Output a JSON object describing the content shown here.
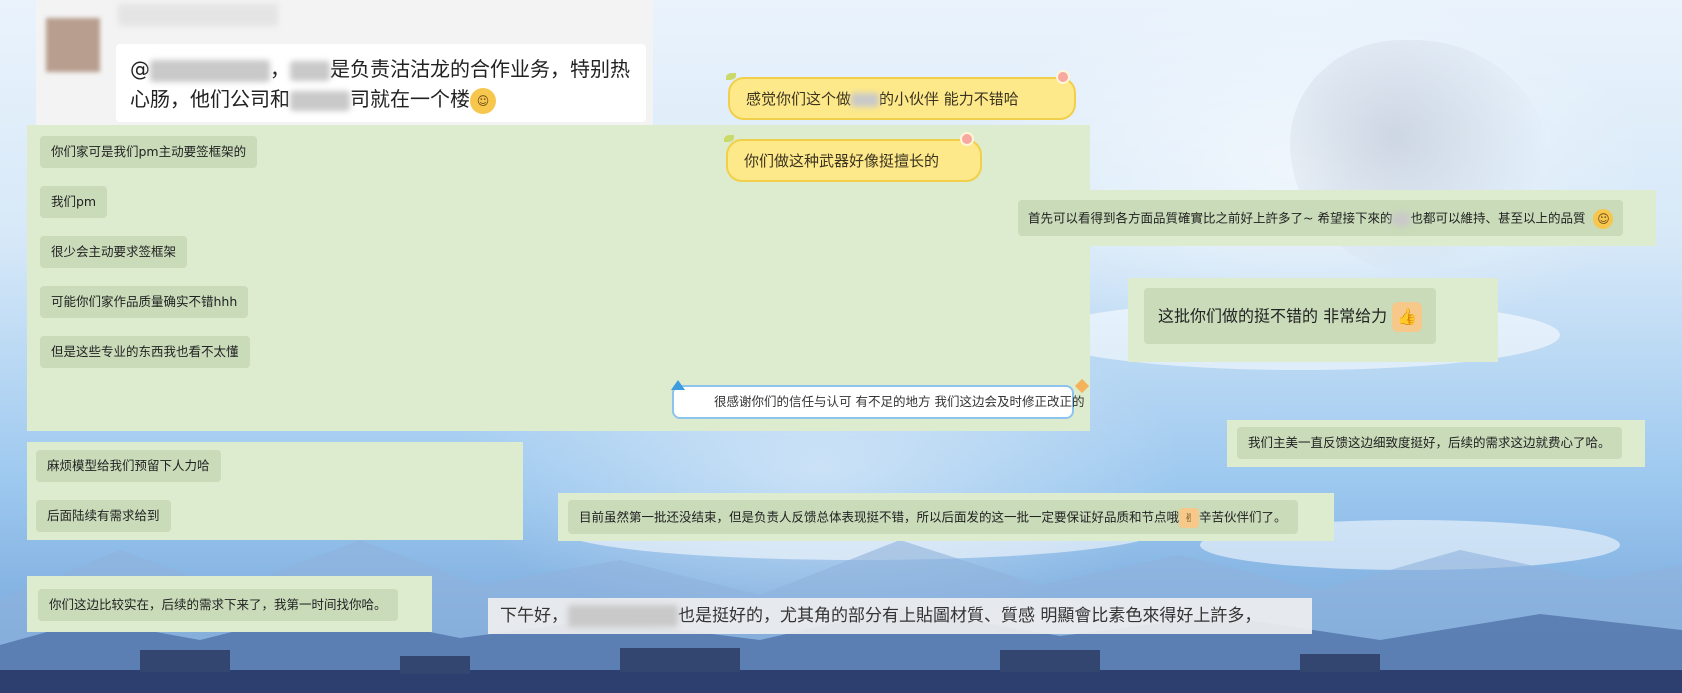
{
  "snippet_top": {
    "message_parts": [
      "@",
      "，",
      "是负责沽沽龙的合作业务，特别热心肠，他们公司和",
      "司就在一个楼"
    ]
  },
  "left_chat": {
    "messages": [
      "你们家可是我们pm主动要签框架的",
      "我们pm",
      "很少会主动要求签框架",
      "可能你们家作品质量确实不错hhh",
      "但是这些专业的东西我也看不太懂"
    ],
    "reply": "很感谢你们的信任与认可 有不足的地方 我们这边会及时修正改正的"
  },
  "yellow_chat": {
    "msg1_parts": [
      "感觉你们这个做",
      "的小伙伴 能力不错哈"
    ],
    "msg2": "你们做这种武器好像挺擅长的"
  },
  "right_quality": {
    "parts": [
      "首先可以看得到各方面品質確實比之前好上許多了~ 希望接下來的",
      "也都可以維持、甚至以上的品質"
    ]
  },
  "right_praise": {
    "text": "这批你们做的挺不错的  非常给力"
  },
  "right_feedback": {
    "text": "我们主美一直反馈这边细致度挺好，后续的需求这边就费心了哈。"
  },
  "left_model": {
    "messages": [
      "麻烦模型给我们预留下人力哈",
      "后面陆续有需求给到"
    ]
  },
  "middle_batch": {
    "parts": [
      "目前虽然第一批还没结束，但是负责人反馈总体表现挺不错，所以后面发的这一批一定要保证好品质和节点哦",
      "辛苦伙伴们了。"
    ]
  },
  "left_solid": {
    "text": "你们这边比较实在，后续的需求下来了，我第一时间找你哈。"
  },
  "bottom_caption": {
    "parts": [
      "下午好，",
      "也是挺好的，尤其角的部分有上貼圖材質、質感 明顯會比素色來得好上許多，"
    ]
  },
  "colors": {
    "chat_pane": "#ddebce",
    "bubble": "#c9dbb9",
    "yellow_bubble": "#fde98a",
    "reply_border": "#8cc4ee"
  },
  "icons": [
    "avatar",
    "grin-emoji",
    "smile-emoji",
    "thumbs-up-emoji",
    "ok-hand-emoji",
    "pin-icon",
    "sparkle-icon"
  ]
}
